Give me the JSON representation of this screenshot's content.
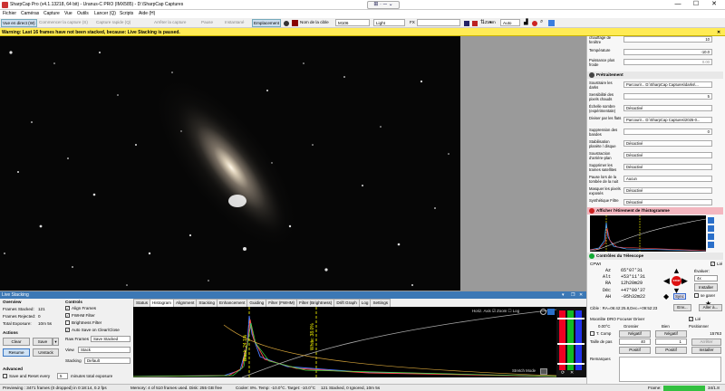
{
  "window": {
    "title": "SharpCap Pro (v4.1.13218, 64 bit) - Uranus-C PRO (IMX585) - D:\\SharpCap Captures",
    "minimize": "—",
    "maximize": "☐",
    "close": "✕"
  },
  "title_center_control": "⊞ · ─ ⌄",
  "menu": [
    "Fichier",
    "Caméras",
    "Capture",
    "Vue",
    "Outils",
    "Lancer (Q)",
    "Scripts",
    "Aide (H)"
  ],
  "toolbar": {
    "live_view": "Vue en direct (W)",
    "start_capture": "Commencer la capture (S)",
    "quick_capture": "Capture rapide (Q)",
    "stop_capture": "Arrêter la capture",
    "pause": "Pause",
    "snapshot": "Instantané",
    "placement": "Emplacement",
    "target_label": "Nom de la cible",
    "target_value": "M106",
    "frame_type": "Light",
    "fx_label": "FX",
    "fx_value": "",
    "zoom_label": "Zoom",
    "zoom_value": "Auto"
  },
  "warning": "Warning: Last 16 frames have not been stacked, because: Live Stacking is paused.",
  "right_panel": {
    "top_rows": [
      {
        "label": "chauffage de fenêtre",
        "value": "10"
      },
      {
        "label": "Température",
        "value": "-10.0"
      },
      {
        "label": "Puissance plus froide",
        "value": "0.00"
      }
    ],
    "preprocessing_title": "Prétraitement",
    "pre_rows": [
      {
        "label": "Soustraire les darks",
        "value": "Parcourir...  D:\\SharpCap Captures\\darks\\..."
      },
      {
        "label": "Sensibilité des pixels chauds",
        "value": "5"
      },
      {
        "label": "Échelle sombre (expérimentale)",
        "value": "Désactivé"
      },
      {
        "label": "Diviser par les flats",
        "value": "Parcourir...  D:\\SharpCap Captures\\2025-0..."
      },
      {
        "label": "Suppression des bandes",
        "value": "0"
      },
      {
        "label": "Stabilisation planète / disque",
        "value": "Désactivé"
      },
      {
        "label": "Soustraction d'arrière-plan",
        "value": "Désactivé"
      },
      {
        "label": "Supprimer les trames satellites",
        "value": "Désactivé"
      },
      {
        "label": "Pause lors de la tombée de la nuit",
        "value": "Aucun"
      },
      {
        "label": "Masquer les pixels exposés",
        "value": "Désactivé"
      },
      {
        "label": "Synthétique Filtre",
        "value": "Désactivé"
      }
    ],
    "histogram_title": "Afficher l'étirement de l'histogramme",
    "scope_title": "Contrôles du Télescope",
    "scope": {
      "name": "CPWI",
      "lie_label": "Lié",
      "rows": [
        {
          "label": "Az",
          "value": "65°07'31"
        },
        {
          "label": "Alt",
          "value": "+53°11'31"
        },
        {
          "label": "RA",
          "value": "12h20m29"
        },
        {
          "label": "Déc",
          "value": "+47°09'37"
        },
        {
          "label": "AH",
          "value": "-05h32m22"
        }
      ],
      "evaluer_label": "Évaluer:",
      "evaluer_value": "4x",
      "installer": "Installer",
      "se_garer": "se garer",
      "stop": "STOP",
      "sync": "Sync",
      "cible_label": "Cible : RA=06:42:25.8,Dec=+09:52:23",
      "env_btn": "Env...",
      "aller_btn": "Aller à..."
    },
    "focuser": {
      "title": "Moonlite DRO Focuser Driver",
      "lie_label": "Lié",
      "temp": "0.00°C",
      "grossier": "Grossier",
      "bien": "Bien",
      "positionner": "Positionner",
      "tcomp": "T. Comp",
      "negatif1": "Négatif",
      "negatif2": "Négatif",
      "position": "15763",
      "taille_label": "Taille de pas",
      "step1": "40",
      "step2": "1",
      "arreter": "Arrêter",
      "positif1": "Positif",
      "positif2": "Positif",
      "installer": "Installer",
      "remarques": "Remarques"
    }
  },
  "live_stacking": {
    "title": "Live Stacking",
    "overview_label": "Overview",
    "frames_stacked_label": "Frames Stacked:",
    "frames_stacked": "121",
    "frames_rejected_label": "Frames Rejected:",
    "frames_rejected": "0",
    "total_exposure_label": "Total Exposure:",
    "total_exposure": "10m 5s",
    "actions_label": "Actions",
    "clear": "Clear",
    "save": "Save",
    "resume": "Resume",
    "unstack": "Unstack",
    "advanced_label": "Advanced",
    "save_reset_label": "Save and Reset every",
    "save_reset_value": "5",
    "save_reset_suffix": "minutes total exposure",
    "controls_label": "Controls",
    "align": "Align Frames",
    "fwhm": "FWHM Filter",
    "brightness": "Brightness Filter",
    "autosave": "Auto Save on Clear/Close",
    "raw_frames_label": "Raw Frames",
    "raw_frames_value": "Save Stacked",
    "view_label": "View",
    "view_value": "Stack",
    "stacking_label": "Stacking",
    "stacking_value": "Default",
    "tabs": [
      "Status",
      "Histogram",
      "Alignment",
      "Stacking",
      "Enhancement",
      "Guiding",
      "Filter (FWHM)",
      "Filter (Brightness)",
      "Drift Graph",
      "Log",
      "Settings"
    ],
    "active_tab": "Histogram",
    "histo_opts": "Horiz. Axis  ☑ Zoom  ☐ Log",
    "stretch_mode": "Stretch Mode",
    "black_level": "Black: 24.1%",
    "white_level": "White: 38.0%"
  },
  "status_bar": {
    "left": "Previewing : 3471 frames (0 dropped) in 0:18:14, 0.2 fps",
    "memory": "Memory: 4 of 510 frames used. Disk: 255 GB free",
    "cooler": "Cooler: 8%. Temp: -10.0°C. Target: -10.0°C",
    "stacked": "121 Stacked, 0 Ignored, 10m 5s",
    "frame_label": "Frame:",
    "frame_value": "34/1.8"
  }
}
